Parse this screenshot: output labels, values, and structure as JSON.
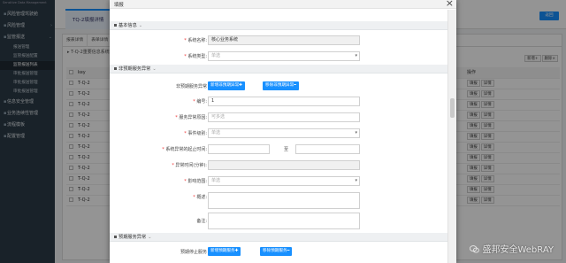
{
  "sidebar": {
    "logo": "Sensitive Data Management",
    "items": [
      {
        "label": "风险管理驾驶舱",
        "icon": "dashboard-icon"
      },
      {
        "label": "风险管理",
        "icon": "warning-icon"
      },
      {
        "label": "监管报送",
        "icon": "send-icon"
      }
    ],
    "subitems": [
      "报送管理",
      "监管报送配置",
      "监管报送列表",
      "审批报送管理",
      "审批报送管理",
      "审批报送管理"
    ],
    "items2": [
      {
        "label": "信息安全管理",
        "icon": "shield-icon"
      },
      {
        "label": "业务连续性管理",
        "icon": "link-icon"
      },
      {
        "label": "流程模板",
        "icon": "flow-icon"
      },
      {
        "label": "配置管理",
        "icon": "gear-icon"
      }
    ]
  },
  "topbar": {
    "tab": "TQ-2填报详情",
    "btn": "返回"
  },
  "panel": {
    "tabs": [
      "报表详情",
      "表单详情"
    ],
    "title": "T-Q-2重要信息系统",
    "btn_add": "新增+",
    "btn_del": "删除×",
    "col_key": "key",
    "col_ops": "操作",
    "rows": [
      "T-Q-2",
      "T-Q-2",
      "T-Q-2",
      "T-Q-2",
      "T-Q-2",
      "T-Q-2",
      "T-Q-2",
      "T-Q-2",
      "T-Q-2",
      "T-Q-2",
      "T-Q-2",
      "T-Q-2"
    ],
    "op_fill": "填报",
    "op_detail": "详情"
  },
  "modal": {
    "title": "填报",
    "close": "×",
    "sec_basic": "基本信息",
    "sys_name_label": "系统名称:",
    "sys_name_value": "核心业务系统",
    "sys_type_label": "系统类型:",
    "sys_type_value": "单选",
    "sec_unplanned": "非预期服务异常",
    "unplanned_label": "非预期服务异常",
    "btn_add_unplanned": "新增非预期异常✚",
    "btn_remove_unplanned": "移除非预期异常━",
    "no_label": "编号:",
    "no_value": "1",
    "reason_label": "服务异常原因:",
    "reason_placeholder": "可多选",
    "event_label": "事件级别:",
    "event_value": "单选",
    "period_label": "系统异常的起止时间:",
    "to_label": "至",
    "duration_label": "异常时间(分钟):",
    "scope_label": "影响范围:",
    "scope_value": "单选",
    "summary_label": "概述:",
    "remark_label": "备注:",
    "sec_planned": "预期服务异常",
    "planned_label": "预期停止服务",
    "btn_add_planned": "新增预期服务✚",
    "btn_remove_planned": "移除预期服务━"
  },
  "watermark": "盛邦安全WebRAY"
}
